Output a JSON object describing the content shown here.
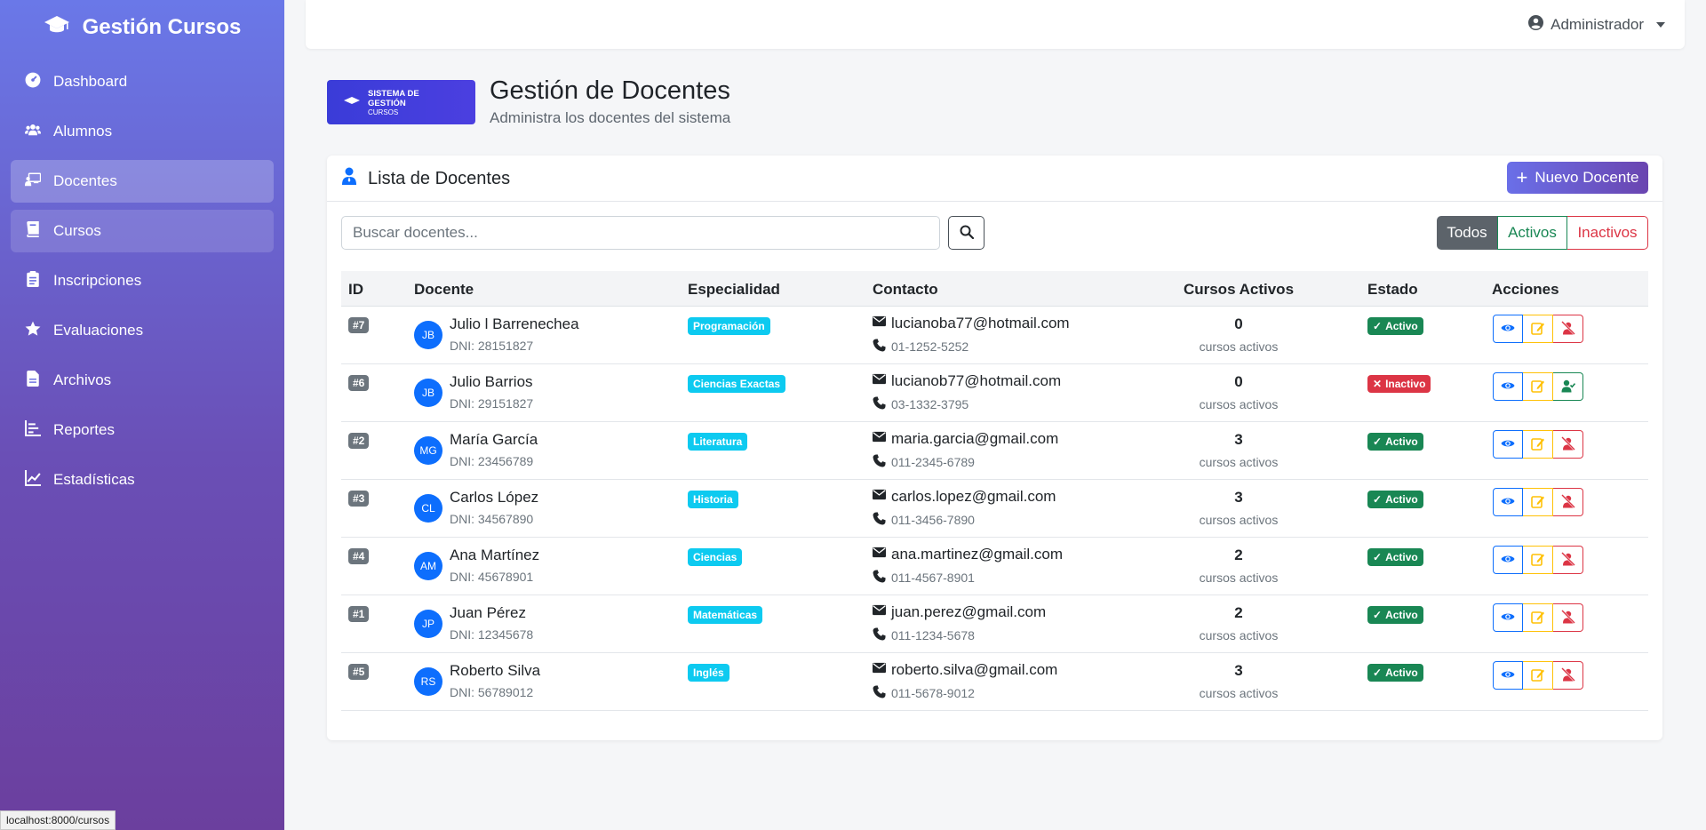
{
  "app": {
    "title": "Gestión Cursos"
  },
  "sidebar": {
    "items": [
      {
        "label": "Dashboard",
        "icon": "dashboard-icon"
      },
      {
        "label": "Alumnos",
        "icon": "users-icon"
      },
      {
        "label": "Docentes",
        "icon": "teacher-icon"
      },
      {
        "label": "Cursos",
        "icon": "book-icon"
      },
      {
        "label": "Inscripciones",
        "icon": "clipboard-icon"
      },
      {
        "label": "Evaluaciones",
        "icon": "star-icon"
      },
      {
        "label": "Archivos",
        "icon": "file-icon"
      },
      {
        "label": "Reportes",
        "icon": "list-icon"
      },
      {
        "label": "Estadísticas",
        "icon": "chart-line-icon"
      }
    ],
    "active": "Docentes",
    "hovered": "Cursos"
  },
  "statusbar": {
    "url": "localhost:8000/cursos"
  },
  "topbar": {
    "user": "Administrador"
  },
  "header": {
    "logo_line1": "SISTEMA DE",
    "logo_line2": "GESTIÓN",
    "logo_line3": "CURSOS",
    "title": "Gestión de Docentes",
    "subtitle": "Administra los docentes del sistema"
  },
  "card": {
    "title": "Lista de Docentes",
    "new_button": "Nuevo Docente",
    "search_placeholder": "Buscar docentes...",
    "filters": {
      "all": "Todos",
      "active": "Activos",
      "inactive": "Inactivos"
    }
  },
  "table": {
    "columns": {
      "id": "ID",
      "docente": "Docente",
      "especialidad": "Especialidad",
      "contacto": "Contacto",
      "cursos": "Cursos Activos",
      "estado": "Estado",
      "acciones": "Acciones"
    },
    "rows": [
      {
        "id": "#7",
        "initials": "JB",
        "name": "Julio l Barrenechea",
        "dni": "DNI: 28151827",
        "specialty": "Programación",
        "email": "lucianoba77@hotmail.com",
        "phone": "01-1252-5252",
        "courses": "0",
        "courses_label": "cursos activos",
        "status": "Activo",
        "active": true
      },
      {
        "id": "#6",
        "initials": "JB",
        "name": "Julio Barrios",
        "dni": "DNI: 29151827",
        "specialty": "Ciencias Exactas",
        "email": "lucianob77@hotmail.com",
        "phone": "03-1332-3795",
        "courses": "0",
        "courses_label": "cursos activos",
        "status": "Inactivo",
        "active": false
      },
      {
        "id": "#2",
        "initials": "MG",
        "name": "María García",
        "dni": "DNI: 23456789",
        "specialty": "Literatura",
        "email": "maria.garcia@gmail.com",
        "phone": "011-2345-6789",
        "courses": "3",
        "courses_label": "cursos activos",
        "status": "Activo",
        "active": true
      },
      {
        "id": "#3",
        "initials": "CL",
        "name": "Carlos López",
        "dni": "DNI: 34567890",
        "specialty": "Historia",
        "email": "carlos.lopez@gmail.com",
        "phone": "011-3456-7890",
        "courses": "3",
        "courses_label": "cursos activos",
        "status": "Activo",
        "active": true
      },
      {
        "id": "#4",
        "initials": "AM",
        "name": "Ana Martínez",
        "dni": "DNI: 45678901",
        "specialty": "Ciencias",
        "email": "ana.martinez@gmail.com",
        "phone": "011-4567-8901",
        "courses": "2",
        "courses_label": "cursos activos",
        "status": "Activo",
        "active": true
      },
      {
        "id": "#1",
        "initials": "JP",
        "name": "Juan Pérez",
        "dni": "DNI: 12345678",
        "specialty": "Matemáticas",
        "email": "juan.perez@gmail.com",
        "phone": "011-1234-5678",
        "courses": "2",
        "courses_label": "cursos activos",
        "status": "Activo",
        "active": true
      },
      {
        "id": "#5",
        "initials": "RS",
        "name": "Roberto Silva",
        "dni": "DNI: 56789012",
        "specialty": "Inglés",
        "email": "roberto.silva@gmail.com",
        "phone": "011-5678-9012",
        "courses": "3",
        "courses_label": "cursos activos",
        "status": "Activo",
        "active": true
      }
    ]
  },
  "colors": {
    "primary": "#0d6efd",
    "success": "#198754",
    "danger": "#dc3545",
    "info": "#0dcaf0",
    "warning": "#ffc107",
    "sidebar_top": "#6a78e8",
    "sidebar_bottom": "#6b3f9e"
  }
}
